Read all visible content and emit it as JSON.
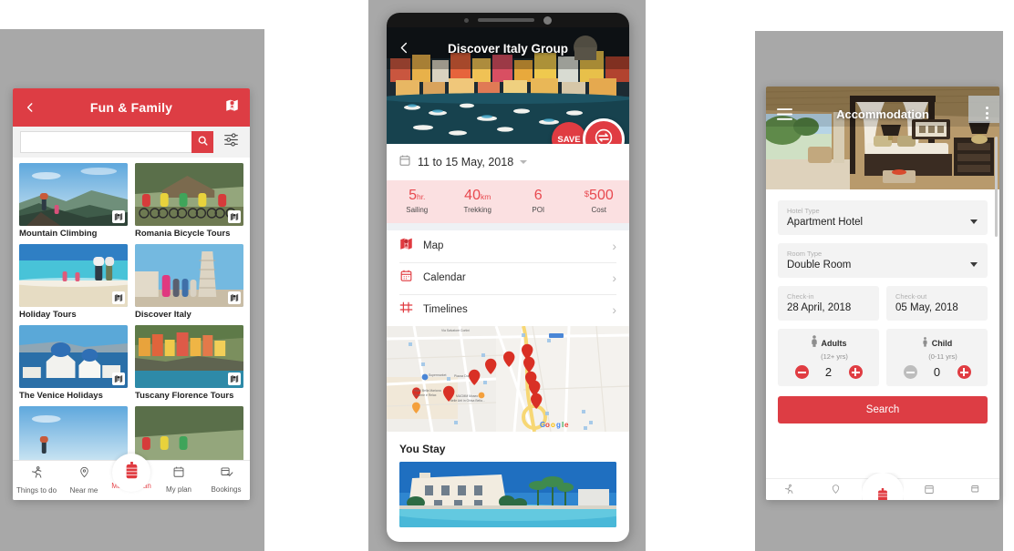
{
  "colors": {
    "brand_red": "#dd3d44",
    "accent_red": "#e03c42",
    "stat_pink_bg": "#fbe0e1",
    "backdrop_grey": "#a8a8a8",
    "field_grey": "#f3f3f3"
  },
  "phone1": {
    "header": {
      "title": "Fun & Family",
      "back_icon": "chevron-left-icon",
      "map_icon": "map-pin-icon"
    },
    "search": {
      "value": "",
      "placeholder": "",
      "search_icon": "search-icon",
      "filter_icon": "sliders-filter-icon"
    },
    "cards": [
      {
        "title": "Mountain Climbing",
        "badge_icon": "map-pin-icon"
      },
      {
        "title": "Romania Bicycle Tours",
        "badge_icon": "map-pin-icon"
      },
      {
        "title": "Holiday Tours",
        "badge_icon": "map-pin-icon"
      },
      {
        "title": "Discover Italy",
        "badge_icon": "map-pin-icon"
      },
      {
        "title": "The Venice Holidays",
        "badge_icon": "map-pin-icon"
      },
      {
        "title": "Tuscany Florence Tours",
        "badge_icon": "map-pin-icon"
      }
    ],
    "tabs": [
      {
        "label": "Things to do",
        "icon": "running-person-icon",
        "active": false
      },
      {
        "label": "Near me",
        "icon": "location-pin-icon",
        "active": false
      },
      {
        "label": "Make a plan",
        "icon": "suitcase-icon",
        "active": true
      },
      {
        "label": "My plan",
        "icon": "calendar-icon",
        "active": false
      },
      {
        "label": "Bookings",
        "icon": "booking-check-icon",
        "active": false
      }
    ]
  },
  "phone2": {
    "hero": {
      "title": "Discover Italy Group",
      "back_icon": "chevron-left-icon",
      "save_label": "SAVE",
      "swap_icon": "swap-arrows-icon"
    },
    "date": {
      "calendar_icon": "calendar-icon",
      "text": "11 to 15 May, 2018",
      "caret_icon": "chevron-down-icon"
    },
    "stats": [
      {
        "value": "5",
        "unit": "hr.",
        "currency": "",
        "label": "Sailing"
      },
      {
        "value": "40",
        "unit": "km",
        "currency": "",
        "label": "Trekking"
      },
      {
        "value": "6",
        "unit": "",
        "currency": "",
        "label": "POI"
      },
      {
        "value": "500",
        "unit": "",
        "currency": "$",
        "label": "Cost"
      }
    ],
    "rows": [
      {
        "label": "Map",
        "icon": "map-pin-icon",
        "chevron": "›"
      },
      {
        "label": "Calendar",
        "icon": "calendar-icon",
        "chevron": "›"
      },
      {
        "label": "Timelines",
        "icon": "timeline-icon",
        "chevron": "›"
      }
    ],
    "map": {
      "watermark": "Google",
      "pin_count": 10,
      "labels": [
        "Via Salvatore Cortini",
        "Piazza Don",
        "Supermarket",
        "Hotel Bella Marana Charme e Relax",
        "MACMM Museo",
        "delle Arti in Ghisa Bella"
      ]
    },
    "you_stay": {
      "heading": "You Stay"
    }
  },
  "phone3": {
    "hero": {
      "title": "Accommodation",
      "menu_icon": "hamburger-menu-icon",
      "overflow_icon": "kebab-menu-icon"
    },
    "fields": [
      {
        "label": "Hotel Type",
        "value": "Apartment Hotel",
        "caret_icon": "caret-down-icon"
      },
      {
        "label": "Room Type",
        "value": "Double Room",
        "caret_icon": "caret-down-icon"
      }
    ],
    "dates": [
      {
        "label": "Check-in",
        "value": "28 April, 2018"
      },
      {
        "label": "Check-out",
        "value": "05 May, 2018"
      }
    ],
    "guests": [
      {
        "title": "Adults",
        "sub": "(12+ yrs)",
        "value": "2",
        "icon": "adult-person-icon",
        "minus_icon": "minus-circle-icon",
        "plus_icon": "plus-circle-icon",
        "minus_enabled": true
      },
      {
        "title": "Child",
        "sub": "(0-11 yrs)",
        "value": "0",
        "icon": "child-person-icon",
        "minus_icon": "minus-circle-icon",
        "plus_icon": "plus-circle-icon",
        "minus_enabled": false
      }
    ],
    "search_button": "Search",
    "tabs": [
      {
        "icon": "running-person-icon",
        "active": false
      },
      {
        "icon": "location-pin-icon",
        "active": false
      },
      {
        "icon": "suitcase-icon",
        "active": true
      },
      {
        "icon": "calendar-icon",
        "active": false
      },
      {
        "icon": "booking-check-icon",
        "active": false
      }
    ]
  }
}
